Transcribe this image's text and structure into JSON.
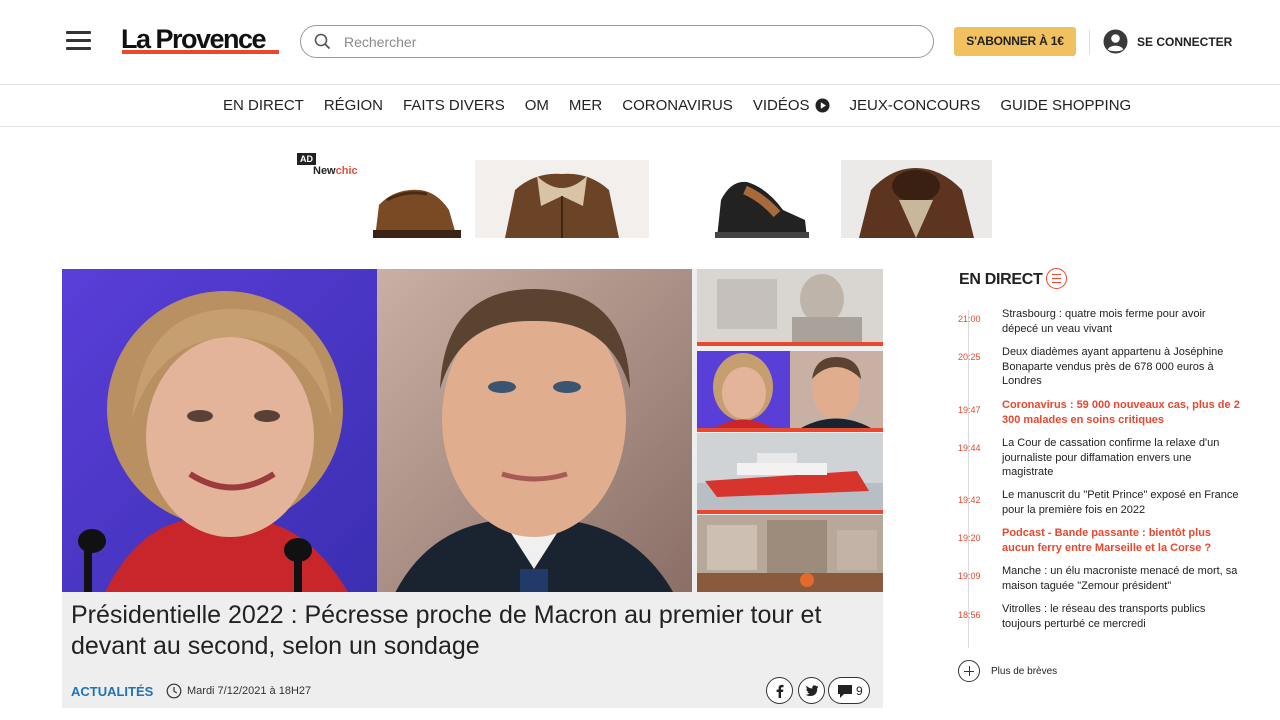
{
  "header": {
    "logo": "La Provence",
    "search_placeholder": "Rechercher",
    "subscribe_label": "S'ABONNER À 1€",
    "login_label": "SE CONNECTER",
    "accent_color": "#e9472e",
    "subscribe_color": "#f1c05f"
  },
  "nav": {
    "items": [
      {
        "label": "EN DIRECT"
      },
      {
        "label": "RÉGION"
      },
      {
        "label": "FAITS DIVERS"
      },
      {
        "label": "OM"
      },
      {
        "label": "MER"
      },
      {
        "label": "CORONAVIRUS"
      },
      {
        "label": "VIDÉOS",
        "icon": "play-circle-icon"
      },
      {
        "label": "JEUX-CONCOURS"
      },
      {
        "label": "GUIDE SHOPPING"
      }
    ]
  },
  "ad": {
    "badge": "AD",
    "brand_prefix": "New",
    "brand_suffix": "chic",
    "info_icon": "info-icon"
  },
  "hero": {
    "title": "Présidentielle 2022 : Pécresse proche de Macron au premier tour et devant au second, selon un sondage",
    "category": "ACTUALITÉS",
    "date": "Mardi 7/12/2021 à 18H27",
    "comments_count": "9"
  },
  "live": {
    "title": "EN DIRECT",
    "items": [
      {
        "time": "21:00",
        "text": "Strasbourg : quatre mois ferme pour avoir dépecé un veau vivant",
        "hot": false
      },
      {
        "time": "20:25",
        "text": "Deux diadèmes ayant appartenu à Joséphine Bonaparte vendus près de 678 000 euros à Londres",
        "hot": false
      },
      {
        "time": "19:47",
        "text": "Coronavirus : 59 000 nouveaux cas, plus de 2 300 malades en soins critiques",
        "hot": true
      },
      {
        "time": "19:44",
        "text": "La Cour de cassation confirme la relaxe d'un journaliste pour diffamation envers une magistrate",
        "hot": false
      },
      {
        "time": "19:42",
        "text": "Le manuscrit du \"Petit Prince\" exposé en France pour la première fois en 2022",
        "hot": false
      },
      {
        "time": "19:20",
        "text": "Podcast - Bande passante : bientôt plus aucun ferry entre Marseille et la Corse ?",
        "hot": true
      },
      {
        "time": "19:09",
        "text": "Manche : un élu macroniste menacé de mort, sa maison taguée \"Zemour président\"",
        "hot": false
      },
      {
        "time": "18:56",
        "text": "Vitrolles : le réseau des transports publics toujours perturbé ce mercredi",
        "hot": false
      }
    ],
    "more_label": "Plus de brèves"
  }
}
